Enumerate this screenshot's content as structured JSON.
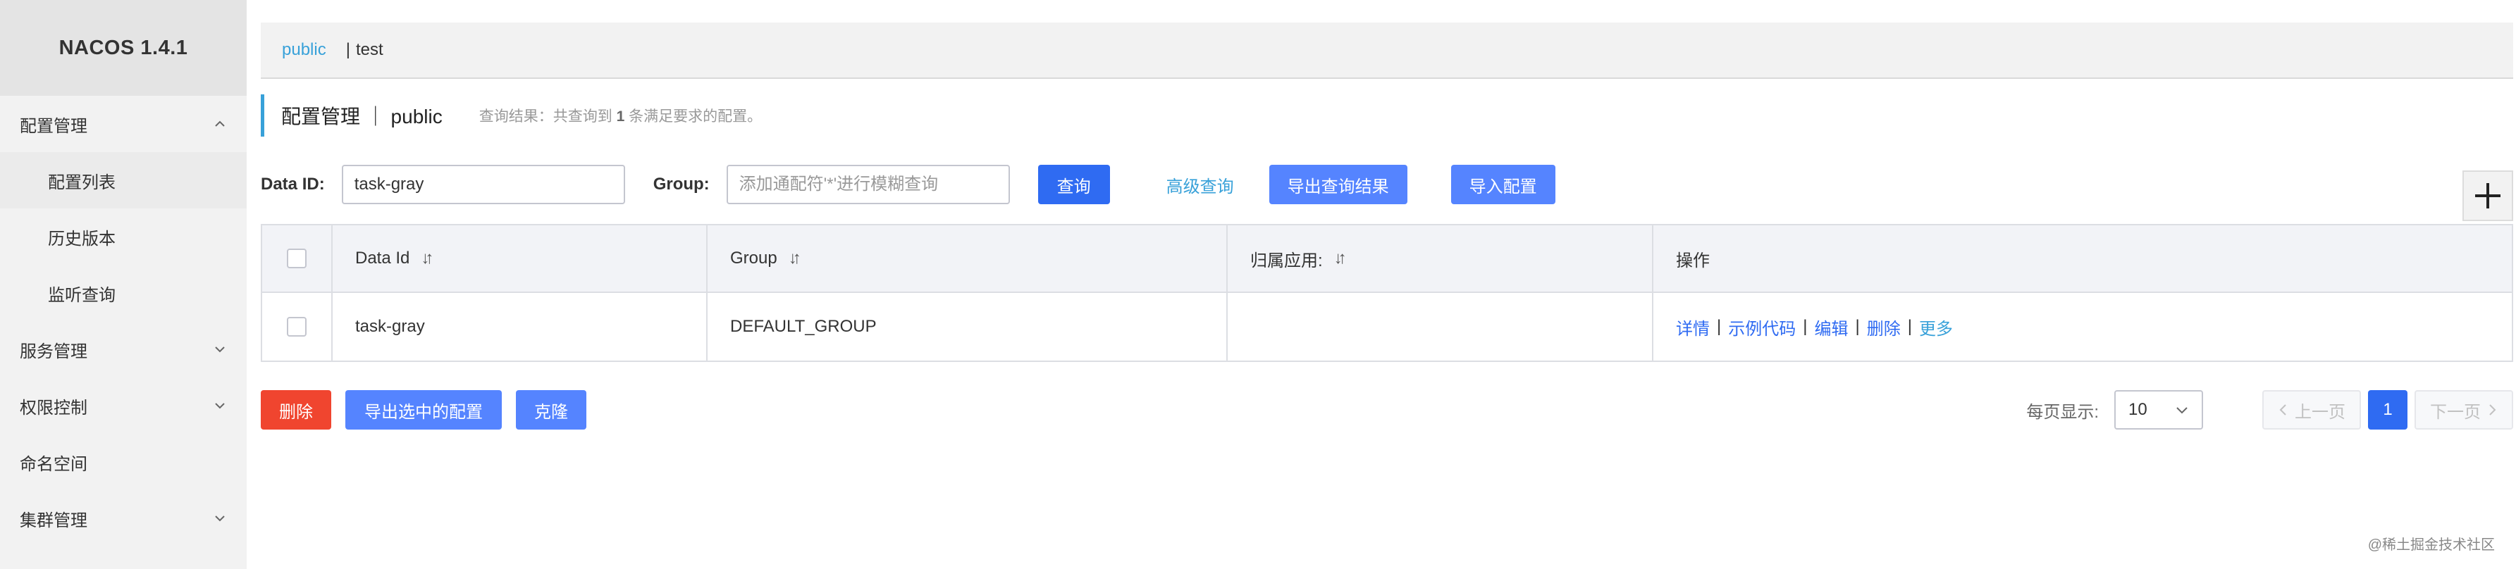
{
  "sidebar": {
    "brand": "NACOS 1.4.1",
    "config_mgmt": "配置管理",
    "config_list": "配置列表",
    "history": "历史版本",
    "listen_query": "监听查询",
    "service_mgmt": "服务管理",
    "auth_control": "权限控制",
    "namespace": "命名空间",
    "cluster_mgmt": "集群管理"
  },
  "namespace_bar": {
    "active": "public",
    "separator": "|",
    "other": "test"
  },
  "header": {
    "title": "配置管理 ｜ public",
    "hint_prefix": "查询结果：共查询到",
    "hint_count": "1",
    "hint_suffix": "条满足要求的配置。"
  },
  "search": {
    "data_id_label": "Data ID:",
    "data_id_value": "task-gray",
    "group_label": "Group:",
    "group_placeholder": "添加通配符'*'进行模糊查询",
    "query_button": "查询",
    "advanced_link": "高级查询",
    "export_results_button": "导出查询结果",
    "import_button": "导入配置",
    "add_icon": "plus-icon"
  },
  "table": {
    "headers": {
      "data_id": "Data Id",
      "group": "Group",
      "app": "归属应用:",
      "ops": "操作"
    },
    "rows": [
      {
        "data_id": "task-gray",
        "group": "DEFAULT_GROUP",
        "app": "",
        "ops": {
          "detail": "详情",
          "sample": "示例代码",
          "edit": "编辑",
          "delete": "删除",
          "more": "更多"
        }
      }
    ]
  },
  "bottom": {
    "delete_button": "删除",
    "export_selected_button": "导出选中的配置",
    "clone_button": "克隆",
    "page_size_label": "每页显示:",
    "page_size_value": "10",
    "prev": "上一页",
    "current_page": "1",
    "next": "下一页"
  },
  "watermark": "@稀土掘金技术社区"
}
